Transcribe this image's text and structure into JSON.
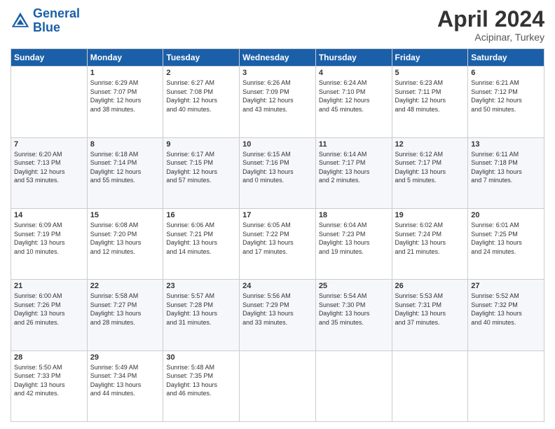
{
  "header": {
    "logo_line1": "General",
    "logo_line2": "Blue",
    "month": "April 2024",
    "location": "Acipinar, Turkey"
  },
  "weekdays": [
    "Sunday",
    "Monday",
    "Tuesday",
    "Wednesday",
    "Thursday",
    "Friday",
    "Saturday"
  ],
  "weeks": [
    [
      {
        "day": "",
        "info": ""
      },
      {
        "day": "1",
        "info": "Sunrise: 6:29 AM\nSunset: 7:07 PM\nDaylight: 12 hours\nand 38 minutes."
      },
      {
        "day": "2",
        "info": "Sunrise: 6:27 AM\nSunset: 7:08 PM\nDaylight: 12 hours\nand 40 minutes."
      },
      {
        "day": "3",
        "info": "Sunrise: 6:26 AM\nSunset: 7:09 PM\nDaylight: 12 hours\nand 43 minutes."
      },
      {
        "day": "4",
        "info": "Sunrise: 6:24 AM\nSunset: 7:10 PM\nDaylight: 12 hours\nand 45 minutes."
      },
      {
        "day": "5",
        "info": "Sunrise: 6:23 AM\nSunset: 7:11 PM\nDaylight: 12 hours\nand 48 minutes."
      },
      {
        "day": "6",
        "info": "Sunrise: 6:21 AM\nSunset: 7:12 PM\nDaylight: 12 hours\nand 50 minutes."
      }
    ],
    [
      {
        "day": "7",
        "info": "Sunrise: 6:20 AM\nSunset: 7:13 PM\nDaylight: 12 hours\nand 53 minutes."
      },
      {
        "day": "8",
        "info": "Sunrise: 6:18 AM\nSunset: 7:14 PM\nDaylight: 12 hours\nand 55 minutes."
      },
      {
        "day": "9",
        "info": "Sunrise: 6:17 AM\nSunset: 7:15 PM\nDaylight: 12 hours\nand 57 minutes."
      },
      {
        "day": "10",
        "info": "Sunrise: 6:15 AM\nSunset: 7:16 PM\nDaylight: 13 hours\nand 0 minutes."
      },
      {
        "day": "11",
        "info": "Sunrise: 6:14 AM\nSunset: 7:17 PM\nDaylight: 13 hours\nand 2 minutes."
      },
      {
        "day": "12",
        "info": "Sunrise: 6:12 AM\nSunset: 7:17 PM\nDaylight: 13 hours\nand 5 minutes."
      },
      {
        "day": "13",
        "info": "Sunrise: 6:11 AM\nSunset: 7:18 PM\nDaylight: 13 hours\nand 7 minutes."
      }
    ],
    [
      {
        "day": "14",
        "info": "Sunrise: 6:09 AM\nSunset: 7:19 PM\nDaylight: 13 hours\nand 10 minutes."
      },
      {
        "day": "15",
        "info": "Sunrise: 6:08 AM\nSunset: 7:20 PM\nDaylight: 13 hours\nand 12 minutes."
      },
      {
        "day": "16",
        "info": "Sunrise: 6:06 AM\nSunset: 7:21 PM\nDaylight: 13 hours\nand 14 minutes."
      },
      {
        "day": "17",
        "info": "Sunrise: 6:05 AM\nSunset: 7:22 PM\nDaylight: 13 hours\nand 17 minutes."
      },
      {
        "day": "18",
        "info": "Sunrise: 6:04 AM\nSunset: 7:23 PM\nDaylight: 13 hours\nand 19 minutes."
      },
      {
        "day": "19",
        "info": "Sunrise: 6:02 AM\nSunset: 7:24 PM\nDaylight: 13 hours\nand 21 minutes."
      },
      {
        "day": "20",
        "info": "Sunrise: 6:01 AM\nSunset: 7:25 PM\nDaylight: 13 hours\nand 24 minutes."
      }
    ],
    [
      {
        "day": "21",
        "info": "Sunrise: 6:00 AM\nSunset: 7:26 PM\nDaylight: 13 hours\nand 26 minutes."
      },
      {
        "day": "22",
        "info": "Sunrise: 5:58 AM\nSunset: 7:27 PM\nDaylight: 13 hours\nand 28 minutes."
      },
      {
        "day": "23",
        "info": "Sunrise: 5:57 AM\nSunset: 7:28 PM\nDaylight: 13 hours\nand 31 minutes."
      },
      {
        "day": "24",
        "info": "Sunrise: 5:56 AM\nSunset: 7:29 PM\nDaylight: 13 hours\nand 33 minutes."
      },
      {
        "day": "25",
        "info": "Sunrise: 5:54 AM\nSunset: 7:30 PM\nDaylight: 13 hours\nand 35 minutes."
      },
      {
        "day": "26",
        "info": "Sunrise: 5:53 AM\nSunset: 7:31 PM\nDaylight: 13 hours\nand 37 minutes."
      },
      {
        "day": "27",
        "info": "Sunrise: 5:52 AM\nSunset: 7:32 PM\nDaylight: 13 hours\nand 40 minutes."
      }
    ],
    [
      {
        "day": "28",
        "info": "Sunrise: 5:50 AM\nSunset: 7:33 PM\nDaylight: 13 hours\nand 42 minutes."
      },
      {
        "day": "29",
        "info": "Sunrise: 5:49 AM\nSunset: 7:34 PM\nDaylight: 13 hours\nand 44 minutes."
      },
      {
        "day": "30",
        "info": "Sunrise: 5:48 AM\nSunset: 7:35 PM\nDaylight: 13 hours\nand 46 minutes."
      },
      {
        "day": "",
        "info": ""
      },
      {
        "day": "",
        "info": ""
      },
      {
        "day": "",
        "info": ""
      },
      {
        "day": "",
        "info": ""
      }
    ]
  ]
}
